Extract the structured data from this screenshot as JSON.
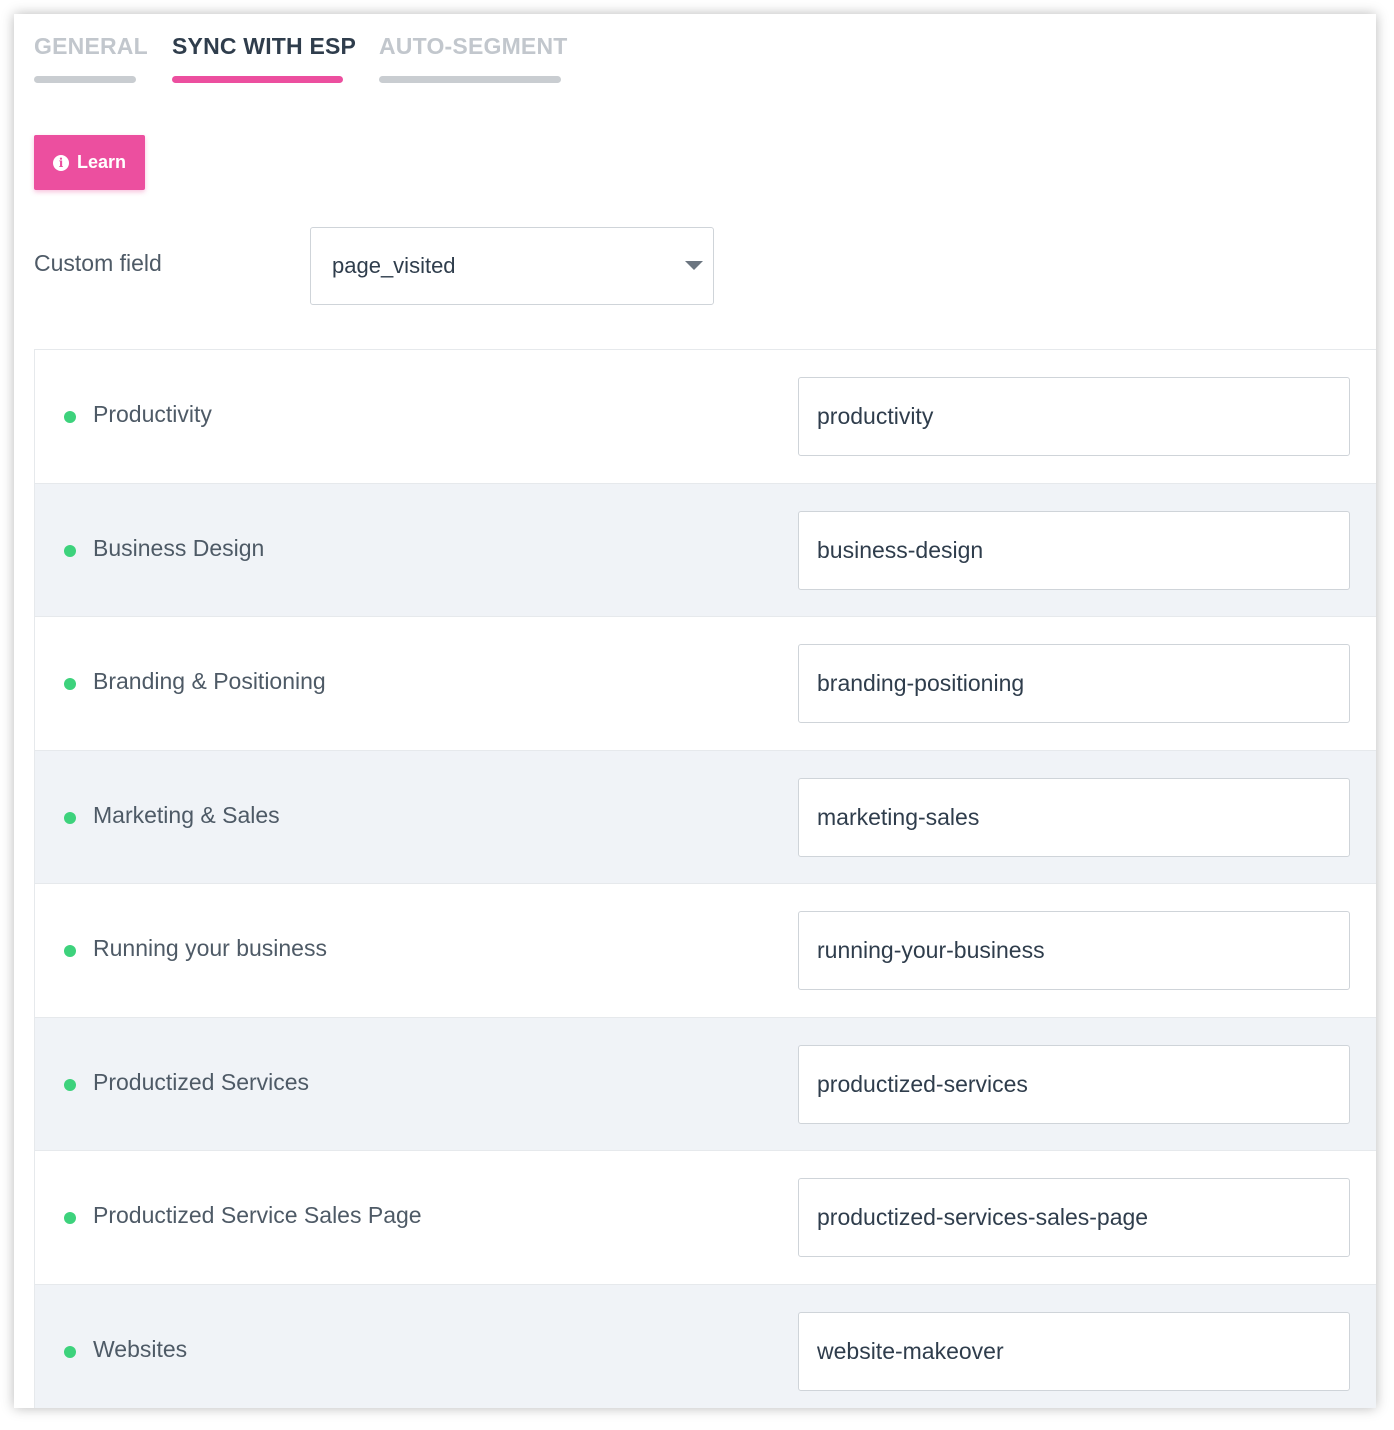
{
  "tabs": [
    {
      "label": "GENERAL",
      "active": false
    },
    {
      "label": "SYNC WITH ESP",
      "active": true
    },
    {
      "label": "AUTO-SEGMENT",
      "active": false
    }
  ],
  "learn_button": {
    "label": "Learn",
    "icon": "info-icon"
  },
  "custom_field": {
    "label": "Custom field",
    "selected": "page_visited"
  },
  "mappings": [
    {
      "label": "Productivity",
      "value": "productivity"
    },
    {
      "label": "Business Design",
      "value": "business-design"
    },
    {
      "label": "Branding & Positioning",
      "value": "branding-positioning"
    },
    {
      "label": "Marketing & Sales",
      "value": "marketing-sales"
    },
    {
      "label": "Running your business",
      "value": "running-your-business"
    },
    {
      "label": "Productized Services",
      "value": "productized-services"
    },
    {
      "label": "Productized Service Sales Page",
      "value": "productized-services-sales-page"
    },
    {
      "label": "Websites",
      "value": "website-makeover"
    }
  ],
  "colors": {
    "accent": "#ec4f9f",
    "status_dot": "#3dd27c",
    "alt_row": "#f0f3f7",
    "text": "#2f3d4c"
  }
}
